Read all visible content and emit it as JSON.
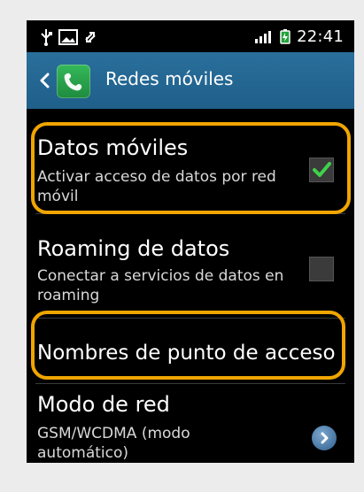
{
  "status_bar": {
    "time": "22:41",
    "icons": [
      "usb-icon",
      "image-icon",
      "sync-icon",
      "signal-icon",
      "battery-icon"
    ]
  },
  "action_bar": {
    "title": "Redes móviles",
    "icon": "phone-icon"
  },
  "settings": [
    {
      "title": "Datos móviles",
      "subtitle": "Activar acceso de datos por red móvil",
      "control": "checkbox",
      "checked": true
    },
    {
      "title": "Roaming de datos",
      "subtitle": "Conectar a servicios de datos en roaming",
      "control": "checkbox",
      "checked": false
    },
    {
      "title": "Nombres de punto de acceso",
      "subtitle": ""
    },
    {
      "title": "Modo de red",
      "subtitle": "GSM/WCDMA (modo automático)",
      "control": "chevron"
    }
  ],
  "colors": {
    "highlight": "#f0a500",
    "action_bar": "#2a6f9c",
    "checkmark": "#3fd14a"
  }
}
